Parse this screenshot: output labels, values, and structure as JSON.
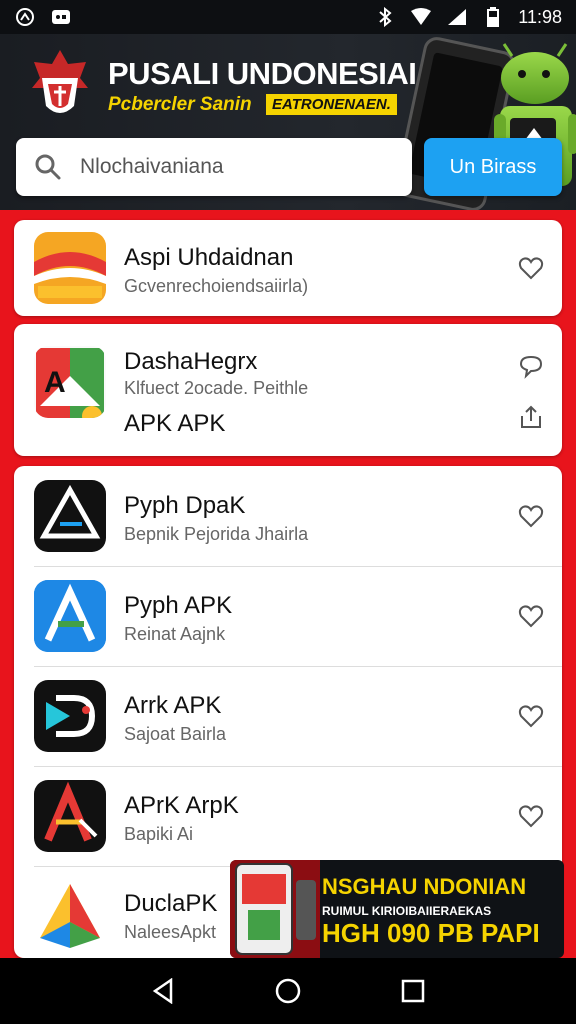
{
  "status_bar": {
    "time": "11:98",
    "left_icons": [
      "pinwheel-icon",
      "photo-icon"
    ],
    "right_icons": [
      "bluetooth-icon",
      "wifi-icon",
      "cell-signal-icon",
      "battery-icon"
    ]
  },
  "header": {
    "title": "PUSALI UNDONESIAI",
    "subtitle": "Pcbercler Sanin",
    "badge": "EATRONENAEN."
  },
  "search": {
    "value": "Nlochaivaniana",
    "button_label": "Un Birass"
  },
  "apps": [
    {
      "title": "Aspi Uhdaidnan",
      "subtitle": "Gcvenrechoiendsaiirla)",
      "icon": "orange-wave-app-icon"
    },
    {
      "title": "DashaHegrx",
      "subtitle": "Klfuect 2ocade. Peithle",
      "extra": "APK APK",
      "icon": "map-app-icon"
    },
    {
      "title": "Pyph DpaK",
      "subtitle": "Bepnik Pejorida Jhairla",
      "icon": "triangle-app-icon"
    },
    {
      "title": "Pyph APK",
      "subtitle": "Reinat Aajnk",
      "icon": "blue-a-app-icon"
    },
    {
      "title": "Arrk APK",
      "subtitle": "Sajoat Bairla",
      "icon": "play-d-app-icon"
    },
    {
      "title": "APrK ArpK",
      "subtitle": "Bapiki Ai",
      "icon": "red-a-app-icon"
    },
    {
      "title": "DuclaPK",
      "subtitle": "NaleesApkt",
      "icon": "colorful-a-app-icon"
    }
  ],
  "promo": {
    "line1": "NSGHAU NDONIAN",
    "line2": "RUIMUL  KIRIOIBAIIERAEKAS",
    "line3": "HGH 090 PB PAPI"
  },
  "colors": {
    "accent_red": "#e8141c",
    "brand_yellow": "#f5d300",
    "button_blue": "#1da1f2"
  }
}
